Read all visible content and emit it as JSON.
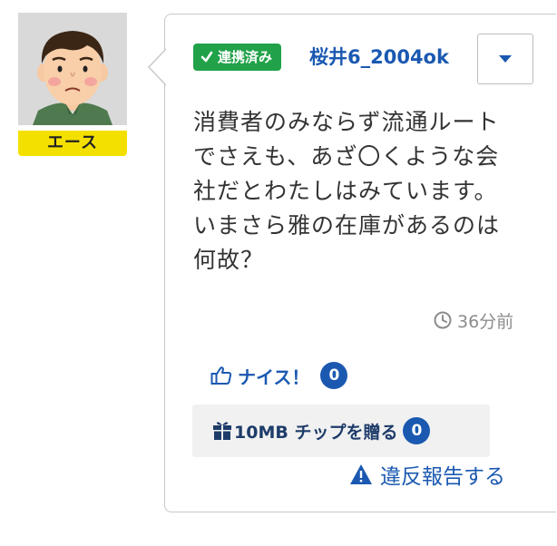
{
  "user": {
    "rank_label": "エース",
    "linked_badge_label": "連携済み",
    "username": "桜井6_2004ok"
  },
  "post": {
    "message": "消費者のみならず流通ルート\nでさえも、あざ〇くような会\n社だとわたしはみています。\nいまさら雅の在庫があるのは\n何故？",
    "timestamp": "36分前"
  },
  "actions": {
    "nice_label": "ナイス！",
    "nice_count": "0",
    "chip_label": "10MB チップを贈る",
    "chip_count": "0",
    "report_label": "違反報告する"
  },
  "colors": {
    "accent_blue": "#1b59b1",
    "linked_green": "#21a249",
    "rank_yellow": "#f4e000"
  },
  "icons": {
    "avatar": "man-face-avatar",
    "linked": "check-icon",
    "menu": "chevron-down-icon",
    "time": "clock-icon",
    "nice": "thumbs-up-icon",
    "chip": "gift-icon",
    "report": "warning-icon"
  }
}
